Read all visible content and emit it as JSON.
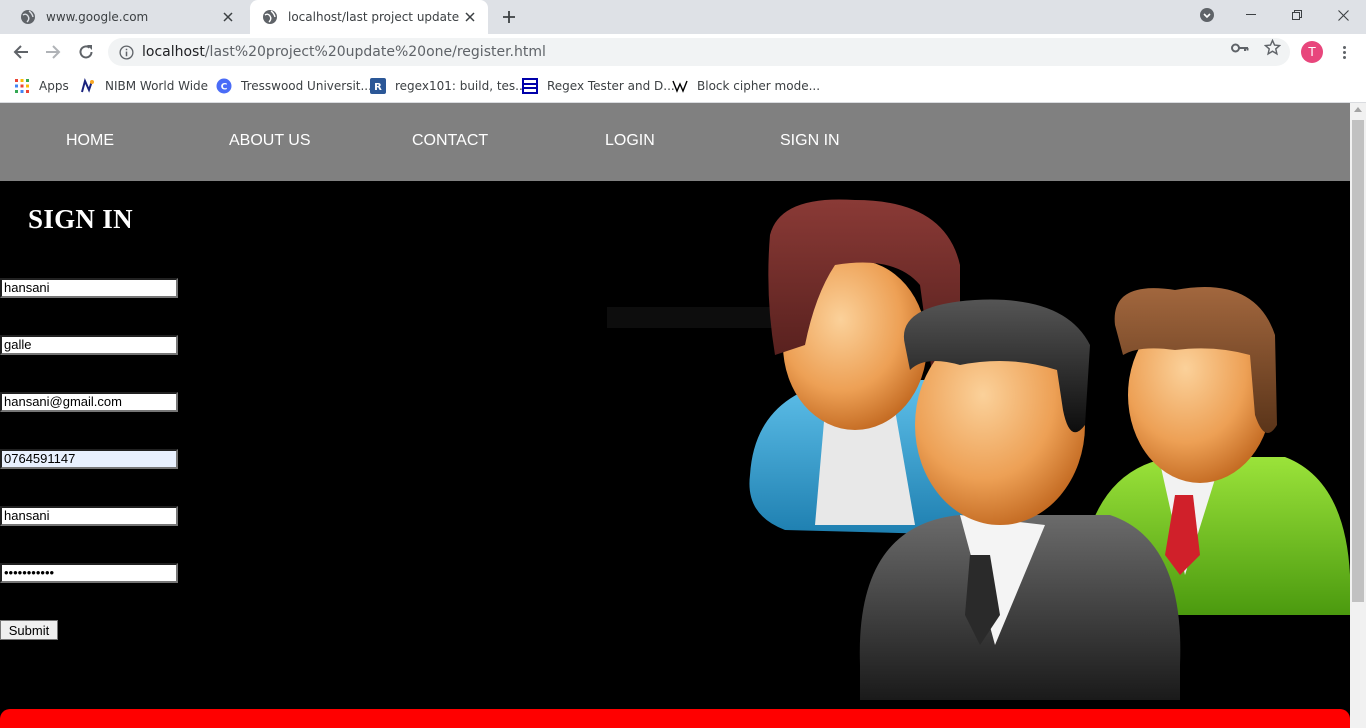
{
  "browser": {
    "tabs": [
      {
        "title": "www.google.com",
        "icon": "globe-icon",
        "active": false
      },
      {
        "title": "localhost/last project update one",
        "icon": "globe-icon",
        "active": true
      }
    ],
    "address": {
      "host": "localhost",
      "path": "/last%20project%20update%20one/register.html"
    },
    "profile_initial": "T",
    "bookmarks": [
      {
        "label": "Apps",
        "icon": "apps-grid-icon"
      },
      {
        "label": "NIBM World Wide",
        "icon": "nibm-icon"
      },
      {
        "label": "Tresswood Universit...",
        "icon": "tresswood-icon"
      },
      {
        "label": "regex101: build, tes...",
        "icon": "regex101-icon"
      },
      {
        "label": "Regex Tester and D...",
        "icon": "regex-tester-icon"
      },
      {
        "label": "Block cipher mode...",
        "icon": "wikipedia-icon"
      }
    ]
  },
  "site": {
    "nav": [
      "HOME",
      "ABOUT US",
      "CONTACT",
      "LOGIN",
      "SIGN IN"
    ],
    "heading": "SIGN IN",
    "fields": [
      {
        "name": "name-field",
        "value": "hansani",
        "type": "text"
      },
      {
        "name": "city-field",
        "value": "galle",
        "type": "text"
      },
      {
        "name": "email-field",
        "value": "hansani@gmail.com",
        "type": "text"
      },
      {
        "name": "phone-field",
        "value": "0764591147",
        "type": "text"
      },
      {
        "name": "username-field",
        "value": "hansani",
        "type": "text"
      },
      {
        "name": "password-field",
        "value": "•••••••••••",
        "type": "password"
      }
    ],
    "submit_label": "Submit",
    "hero_image": "users-group-illustration",
    "colors": {
      "nav_bg": "#808080",
      "page_bg": "#000000",
      "footer_bar": "#ff0000"
    }
  }
}
